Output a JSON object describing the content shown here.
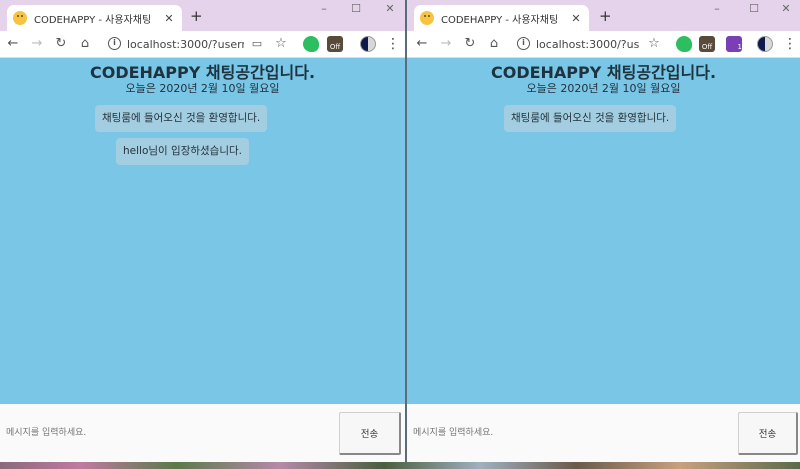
{
  "browser": {
    "tab_title": "CODEHAPPY - 사용자채팅",
    "new_tab_label": "+",
    "left_url": "localhost:3000/?userna...",
    "right_url": "localhost:3000/?use...",
    "window_controls": {
      "minimize": "–",
      "maximize": "☐",
      "close": "✕"
    },
    "ext_off_label": "Off",
    "ext_badge_count": "1"
  },
  "chat": {
    "title": "CODEHAPPY 채팅공간입니다.",
    "date": "오늘은 2020년 2월 10일 월요일",
    "welcome_message": "채팅룸에 들어오신 것을 환영합니다.",
    "join_message": "hello님이 입장하셨습니다.",
    "input_placeholder": "메시지를 입력하세요.",
    "send_label": "전송"
  },
  "colors": {
    "chat_background": "#79c6e6",
    "message_bubble": "#a3cde0",
    "titlebar": "#e4d3ea"
  }
}
